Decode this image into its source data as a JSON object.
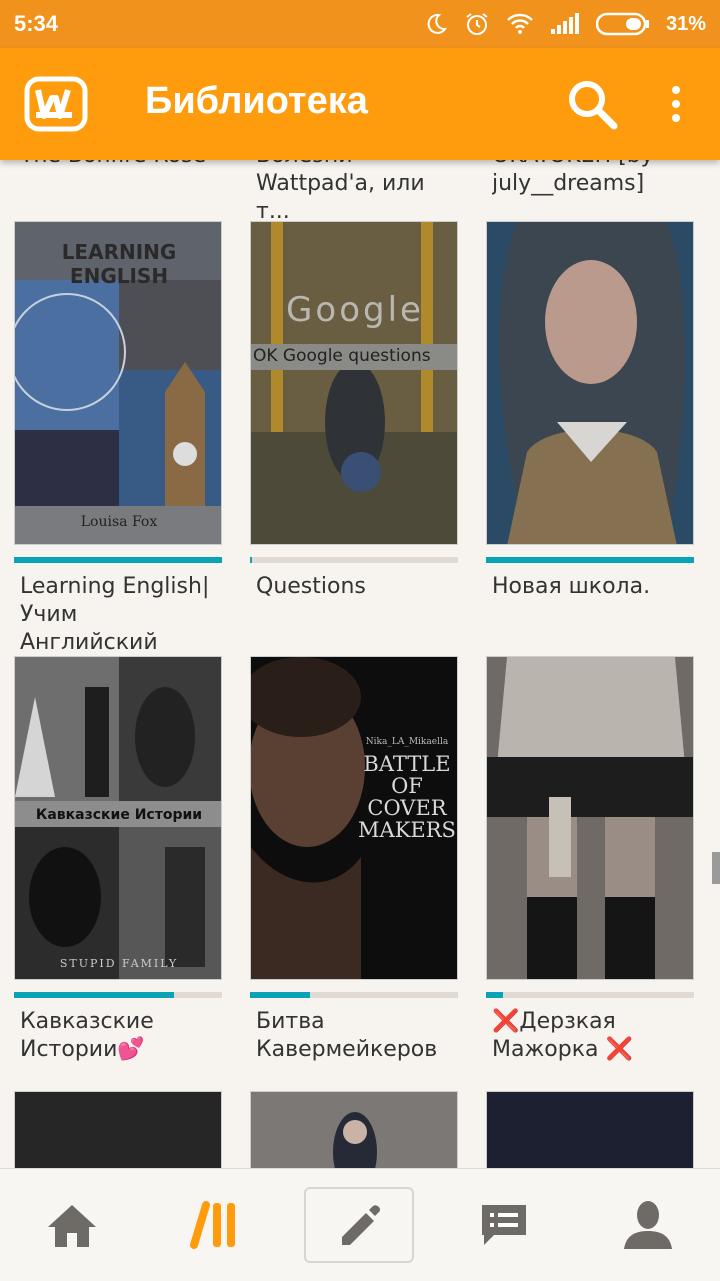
{
  "status_bar": {
    "time": "5:34",
    "battery": "31%"
  },
  "app_bar": {
    "logo_letter": "W",
    "title": "Библиотека",
    "icons": {
      "search": "search-icon",
      "more": "more-vert-icon"
    }
  },
  "library": {
    "partial_row_titles": [
      "The Bonfire Rose",
      "Болезни Wattpad'a, или т...",
      "OKAYOKEH [by july__dreams]"
    ],
    "partial_row_visible": [
      "The Bonfire Rose",
      "Болезни\nWattpad'a, или т...",
      "OKAYOKEH [by\njuly__dreams]"
    ],
    "books": [
      {
        "title": "Learning English|\nУчим Английский",
        "cover_heading": "LEARNING ENGLISH",
        "cover_author": "Louisa Fox",
        "progress": 1.0
      },
      {
        "title": "Questions",
        "cover_heading": "Google",
        "cover_subheading": "OK Google questions",
        "progress": 0.01
      },
      {
        "title": "Новая школа.",
        "progress": 1.0
      },
      {
        "title": "Кавказские\nИстории💕",
        "cover_heading": "Кавказские Истории",
        "cover_footer": "STUPID FAMILY",
        "progress": 0.77
      },
      {
        "title": "Битва\nКавермейкеров",
        "cover_author": "Nika_LA_Mikaella",
        "cover_heading": "BATTLE OF COVER MAKERS",
        "progress": 0.29
      },
      {
        "title": "❌Дерзкая\nМажорка ❌",
        "progress": 0.08
      }
    ]
  },
  "bottom_nav": [
    {
      "name": "home",
      "icon": "home-icon"
    },
    {
      "name": "library",
      "icon": "library-icon"
    },
    {
      "name": "write",
      "icon": "pencil-icon"
    },
    {
      "name": "messages",
      "icon": "messages-icon"
    },
    {
      "name": "profile",
      "icon": "profile-icon"
    }
  ],
  "colors": {
    "accent": "#ff9c0e",
    "statusbar": "#f0921c",
    "progress": "#0aa3b6",
    "background": "#f7f3ee"
  }
}
